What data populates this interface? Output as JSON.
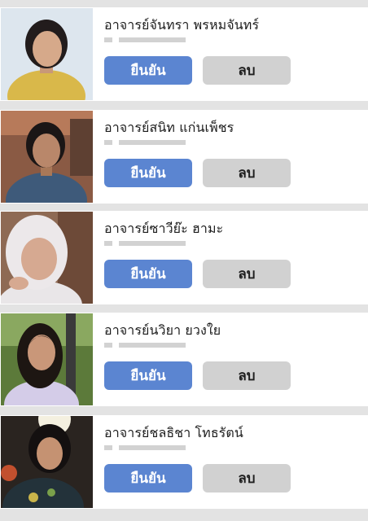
{
  "ui": {
    "accent": "#5b85d1",
    "delete_bg": "#d1d1d1",
    "page_bg": "#e3e3e3"
  },
  "requests": [
    {
      "name": "อาจารย์จันทรา พรหมจันทร์",
      "confirm_label": "ยืนยัน",
      "delete_label": "ลบ"
    },
    {
      "name": "อาจารย์สนิท แก่นเพ็ชร",
      "confirm_label": "ยืนยัน",
      "delete_label": "ลบ"
    },
    {
      "name": "อาจารย์ซาวีย๊ะ ฮามะ",
      "confirm_label": "ยืนยัน",
      "delete_label": "ลบ"
    },
    {
      "name": "อาจารย์นวิยา ยวงใย",
      "confirm_label": "ยืนยัน",
      "delete_label": "ลบ"
    },
    {
      "name": "อาจารย์ชลธิชา โทธรัตน์",
      "confirm_label": "ยืนยัน",
      "delete_label": "ลบ"
    }
  ]
}
